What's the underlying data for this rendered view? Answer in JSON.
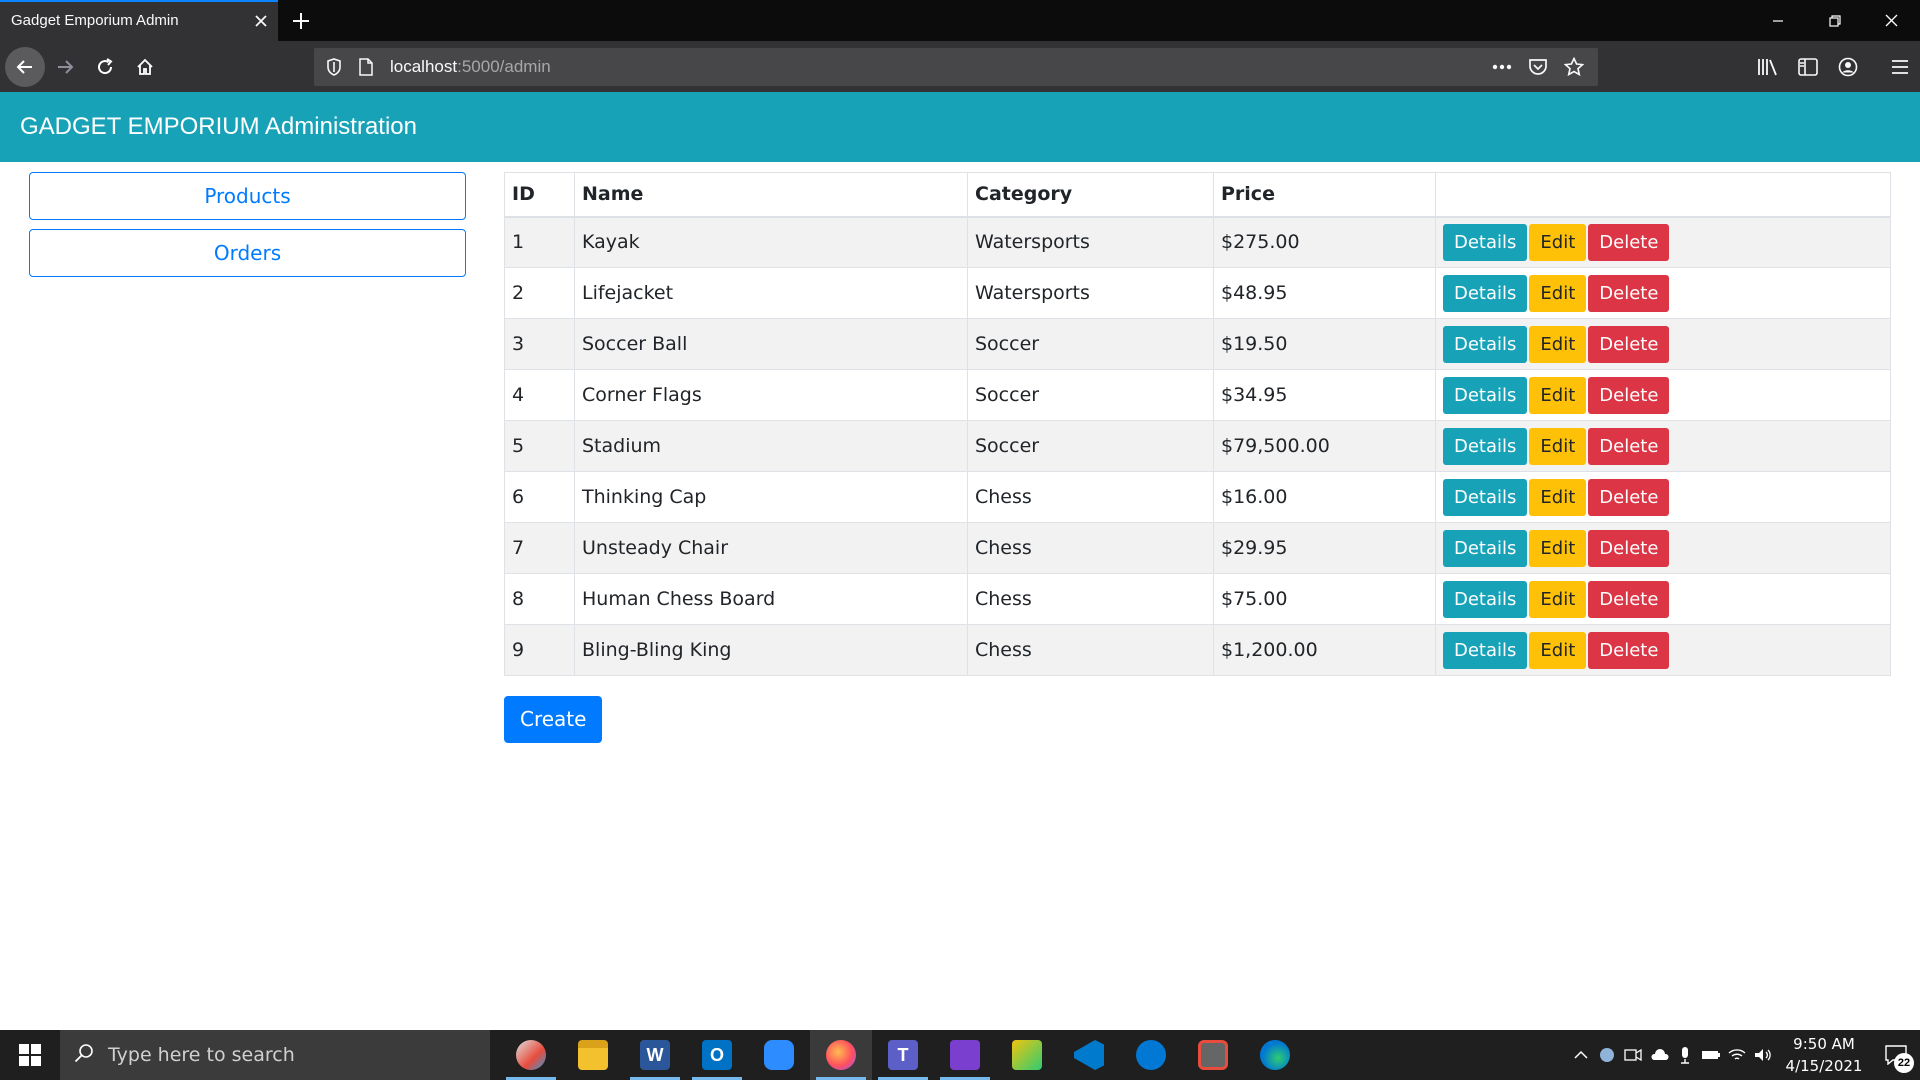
{
  "browser": {
    "tab_title": "Gadget Emporium Admin",
    "url_host": "localhost",
    "url_path": ":5000/admin"
  },
  "header": {
    "title": "GADGET EMPORIUM Administration"
  },
  "sidebar": {
    "items": [
      {
        "label": "Products"
      },
      {
        "label": "Orders"
      }
    ]
  },
  "table": {
    "headers": [
      "ID",
      "Name",
      "Category",
      "Price",
      ""
    ],
    "rows": [
      {
        "id": "1",
        "name": "Kayak",
        "category": "Watersports",
        "price": "$275.00"
      },
      {
        "id": "2",
        "name": "Lifejacket",
        "category": "Watersports",
        "price": "$48.95"
      },
      {
        "id": "3",
        "name": "Soccer Ball",
        "category": "Soccer",
        "price": "$19.50"
      },
      {
        "id": "4",
        "name": "Corner Flags",
        "category": "Soccer",
        "price": "$34.95"
      },
      {
        "id": "5",
        "name": "Stadium",
        "category": "Soccer",
        "price": "$79,500.00"
      },
      {
        "id": "6",
        "name": "Thinking Cap",
        "category": "Chess",
        "price": "$16.00"
      },
      {
        "id": "7",
        "name": "Unsteady Chair",
        "category": "Chess",
        "price": "$29.95"
      },
      {
        "id": "8",
        "name": "Human Chess Board",
        "category": "Chess",
        "price": "$75.00"
      },
      {
        "id": "9",
        "name": "Bling-Bling King",
        "category": "Chess",
        "price": "$1,200.00"
      }
    ],
    "actions": {
      "details": "Details",
      "edit": "Edit",
      "delete": "Delete"
    }
  },
  "create_label": "Create",
  "taskbar": {
    "search_placeholder": "Type here to search",
    "time": "9:50 AM",
    "date": "4/15/2021",
    "notification_count": "22"
  },
  "colors": {
    "header_bg": "#17a2b8",
    "primary": "#007bff",
    "info": "#17a2b8",
    "warning": "#ffc107",
    "danger": "#dc3545"
  }
}
